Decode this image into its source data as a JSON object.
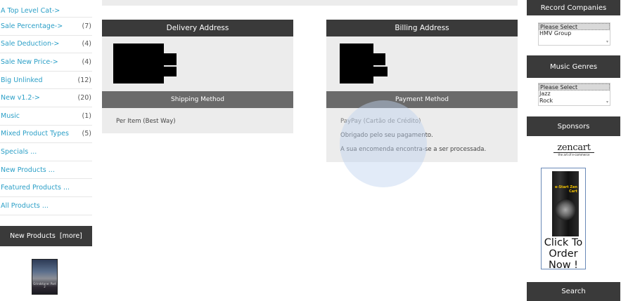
{
  "categories": [
    {
      "label": "A Top Level Cat->",
      "count": ""
    },
    {
      "label": "Sale Percentage->",
      "count": "(7)"
    },
    {
      "label": "Sale Deduction->",
      "count": "(4)"
    },
    {
      "label": "Sale New Price->",
      "count": "(4)"
    },
    {
      "label": "Big Unlinked",
      "count": "(12)"
    },
    {
      "label": "New v1.2->",
      "count": "(20)"
    },
    {
      "label": "Music",
      "count": "(1)"
    },
    {
      "label": "Mixed Product Types",
      "count": "(5)"
    },
    {
      "label": "Specials ...",
      "count": ""
    },
    {
      "label": "New Products ...",
      "count": ""
    },
    {
      "label": "Featured Products ...",
      "count": ""
    },
    {
      "label": "All Products ...",
      "count": ""
    }
  ],
  "new_products": {
    "title": "New Products",
    "more": "[more]",
    "thumb_text": "Grindstone: Part 2"
  },
  "delivery": {
    "title": "Delivery Address",
    "shipping_title": "Shipping Method",
    "shipping_value": "Per Item (Best Way)"
  },
  "billing": {
    "title": "Billing Address",
    "payment_title": "Payment Method",
    "payment_value": "PayPay (Cartão de Crédito)",
    "thanks": "Obrigado pelo seu pagamento.",
    "status": "A sua encomenda encontra-se a ser processada."
  },
  "record_companies": {
    "title": "Record Companies",
    "options": [
      "Please Select",
      "HMV Group"
    ]
  },
  "music_genres": {
    "title": "Music Genres",
    "options": [
      "Please Select",
      "Jazz",
      "Rock"
    ]
  },
  "sponsors": {
    "title": "Sponsors",
    "logo_word": "zencart",
    "logo_tag": "the art of e-commerce",
    "ad_brand": "e-Start Zen Cart",
    "ad_text": "Click To Order Now !"
  },
  "search": {
    "title": "Search"
  }
}
